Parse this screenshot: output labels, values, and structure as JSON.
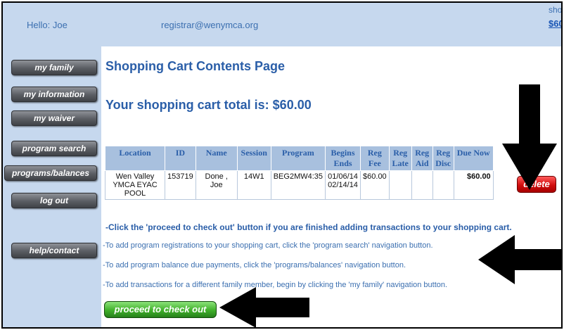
{
  "header": {
    "greeting": "Hello: Joe",
    "email": "registrar@wenymca.org",
    "shop_label": "sho",
    "shop_amount": "$60"
  },
  "sidebar": {
    "items": [
      {
        "label": "my family"
      },
      {
        "label": "my information"
      },
      {
        "label": "my waiver"
      },
      {
        "label": "program search"
      },
      {
        "label": "programs/balances"
      },
      {
        "label": "log out"
      },
      {
        "label": "help/contact"
      }
    ]
  },
  "main": {
    "title": "Shopping Cart Contents Page",
    "total_text": "Your shopping cart total is: $60.00",
    "table": {
      "headers": [
        "Location",
        "ID",
        "Name",
        "Session",
        "Program",
        "Begins Ends",
        "Reg Fee",
        "Reg Late",
        "Reg Aid",
        "Reg Disc",
        "Due Now"
      ],
      "rows": [
        {
          "location": "Wen Valley YMCA EYAC POOL",
          "id": "153719",
          "name": "Done , Joe",
          "session": "14W1",
          "program": "BEG2MW4:35",
          "begins_ends": "01/06/14 02/14/14",
          "reg_fee": "$60.00",
          "reg_late": "",
          "reg_aid": "",
          "reg_disc": "",
          "due_now": "$60.00"
        }
      ]
    },
    "delete_label": "delete",
    "instructions": {
      "bold": "-Click the 'proceed to check out' button if you are finished adding transactions to your shopping cart.",
      "line1": "-To add program registrations to your shopping cart, click the 'program search' navigation button.",
      "line2": "-To add program balance due payments, click the 'programs/balances' navigation button.",
      "line3": "-To add transactions for a different family member, begin by clicking the 'my family' navigation button."
    },
    "checkout_label": "proceed to check out"
  },
  "colors": {
    "background": "#c6d8ee",
    "title_blue": "#2a5ea8",
    "delete_red": "#d10e0e",
    "checkout_green": "#3fb02a"
  }
}
